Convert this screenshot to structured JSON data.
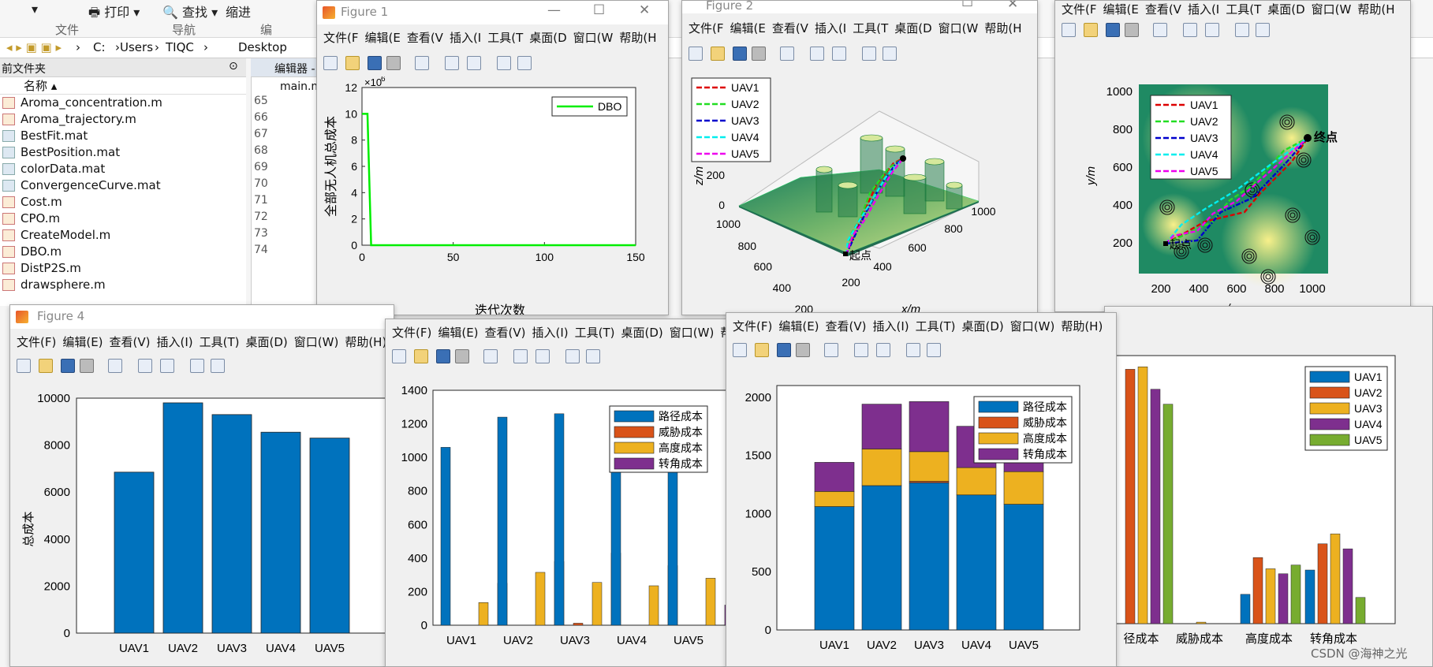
{
  "ribbon": {
    "print_label": "打印",
    "find_label": "查找",
    "indent_label": "缩进",
    "group_file": "文件",
    "group_nav": "导航",
    "group_edit": "编"
  },
  "address": {
    "parts": [
      "C:",
      "Users",
      "TIQC",
      "Desktop"
    ],
    "seps": [
      "›",
      "›",
      "›",
      "›"
    ]
  },
  "folder_panel": {
    "title": "前文件夹",
    "col_name": "名称 ▴",
    "files": [
      "Aroma_concentration.m",
      "Aroma_trajectory.m",
      "BestFit.mat",
      "BestPosition.mat",
      "colorData.mat",
      "ConvergenceCurve.mat",
      "Cost.m",
      "CPO.m",
      "CreateModel.m",
      "DBO.m",
      "DistP2S.m",
      "drawsphere.m"
    ]
  },
  "editor": {
    "title": "编辑器 -",
    "tab": "main.m",
    "line_numbers": [
      "65",
      "66",
      "67",
      "68",
      "69",
      "70",
      "71",
      "72",
      "73",
      "74"
    ]
  },
  "menus": {
    "full": [
      "文件(F)",
      "编辑(E)",
      "查看(V)",
      "插入(I)",
      "工具(T)",
      "桌面(D)",
      "窗口(W)",
      "帮助(H)"
    ],
    "fig1": [
      "文件(F",
      "编辑(E",
      "查看(V",
      "插入(I",
      "工具(T",
      "桌面(D",
      "窗口(W",
      "帮助(H"
    ],
    "fig2": [
      "文件(F",
      "编辑(E",
      "查看(V",
      "插入(I",
      "工具(T",
      "桌面(D",
      "窗口(W",
      "帮助(H"
    ],
    "fig3": [
      "文件(F",
      "编辑(E",
      "查看(V",
      "插入(I",
      "工具(T",
      "桌面(D",
      "窗口(W",
      "帮助(H"
    ],
    "fig_bar": [
      "文件(F)",
      "编辑(E)",
      "查看(V)",
      "插入(I)",
      "工具(T)",
      "桌面(D)",
      "窗口(W)",
      "帮助("
    ]
  },
  "windows": {
    "fig1": {
      "title": "Figure 1",
      "min": "—",
      "max": "☐",
      "close": "✕"
    },
    "fig2": {
      "title": "Figure 2",
      "max": "☐",
      "close": "✕"
    },
    "fig4": {
      "title": "Figure 4"
    }
  },
  "colors": {
    "blue": "#0072BD",
    "orange": "#D95319",
    "yellow": "#EDB120",
    "purple": "#7E2F8E",
    "green": "#77AC30",
    "dbo": "#00EE00"
  },
  "chart_data": [
    {
      "type": "line",
      "id": "convergence",
      "series": [
        {
          "name": "DBO",
          "x": [
            0,
            3,
            5,
            150
          ],
          "y": [
            10000000,
            10000000,
            0,
            0
          ]
        }
      ],
      "xlabel": "迭代次数",
      "ylabel": "全部无人机总成本",
      "xlim": [
        0,
        150
      ],
      "ylim": [
        0,
        12
      ],
      "exponent": "×10",
      "exponent_power": "6",
      "xticks": [
        "0",
        "50",
        "100",
        "150"
      ],
      "yticks": [
        "0",
        "2",
        "4",
        "6",
        "8",
        "10",
        "12"
      ]
    },
    {
      "type": "line",
      "id": "path3d",
      "series": [
        {
          "name": "UAV1"
        },
        {
          "name": "UAV2"
        },
        {
          "name": "UAV3"
        },
        {
          "name": "UAV4"
        },
        {
          "name": "UAV5"
        }
      ],
      "xlabel": "x/m",
      "zlabel": "z/m",
      "start_label": "起点",
      "xticks": [
        "200",
        "400",
        "600",
        "800",
        "1000"
      ],
      "yticks": [
        "200",
        "400",
        "600",
        "800",
        "1000"
      ],
      "zticks": [
        "0",
        "200"
      ]
    },
    {
      "type": "line",
      "id": "path2d",
      "series": [
        {
          "name": "UAV1"
        },
        {
          "name": "UAV2"
        },
        {
          "name": "UAV3"
        },
        {
          "name": "UAV4"
        },
        {
          "name": "UAV5"
        }
      ],
      "xlabel": "x/m",
      "ylabel": "y/m",
      "start_label": "起点",
      "end_label": "终点",
      "xticks": [
        "200",
        "400",
        "600",
        "800",
        "1000"
      ],
      "yticks": [
        "200",
        "400",
        "600",
        "800",
        "1000"
      ]
    },
    {
      "type": "bar",
      "id": "total_cost",
      "categories": [
        "UAV1",
        "UAV2",
        "UAV3",
        "UAV4",
        "UAV5"
      ],
      "values": [
        6850,
        9800,
        9300,
        8550,
        8300
      ],
      "ylabel": "总成本",
      "ylim": [
        0,
        10000
      ],
      "yticks": [
        "0",
        "2000",
        "4000",
        "6000",
        "8000",
        "10000"
      ]
    },
    {
      "type": "bar",
      "id": "cost_grouped",
      "categories": [
        "UAV1",
        "UAV2",
        "UAV3",
        "UAV4",
        "UAV5"
      ],
      "series": [
        {
          "name": "路径成本",
          "values": [
            1060,
            1240,
            1260,
            1160,
            1080
          ]
        },
        {
          "name": "威胁成本",
          "values": [
            0,
            0,
            12,
            0,
            0
          ]
        },
        {
          "name": "高度成本",
          "values": [
            135,
            315,
            255,
            235,
            280
          ]
        },
        {
          "name": "转角成本",
          "values": [
            250,
            380,
            430,
            355,
            120
          ]
        }
      ],
      "ylim": [
        0,
        1400
      ],
      "yticks": [
        "0",
        "200",
        "400",
        "600",
        "800",
        "1000",
        "1200",
        "1400"
      ]
    },
    {
      "type": "bar",
      "id": "cost_stacked",
      "categories": [
        "UAV1",
        "UAV2",
        "UAV3",
        "UAV4",
        "UAV5"
      ],
      "series": [
        {
          "name": "路径成本",
          "values": [
            1060,
            1240,
            1265,
            1160,
            1080
          ]
        },
        {
          "name": "威胁成本",
          "values": [
            0,
            0,
            12,
            0,
            0
          ]
        },
        {
          "name": "高度成本",
          "values": [
            130,
            315,
            255,
            235,
            280
          ]
        },
        {
          "name": "转角成本",
          "values": [
            250,
            385,
            430,
            355,
            125
          ]
        }
      ],
      "ylim": [
        0,
        2100
      ],
      "yticks": [
        "0",
        "500",
        "1000",
        "1500",
        "2000"
      ]
    },
    {
      "type": "bar",
      "id": "cost_by_type",
      "categories": [
        "径成本",
        "威胁成本",
        "高度成本",
        "转角成本"
      ],
      "series": [
        {
          "name": "UAV1",
          "values": [
            0,
            0,
            235,
            430
          ]
        },
        {
          "name": "UAV2",
          "values": [
            2040,
            0,
            530,
            640
          ]
        },
        {
          "name": "UAV3",
          "values": [
            2060,
            12,
            440,
            720
          ]
        },
        {
          "name": "UAV4",
          "values": [
            1880,
            0,
            400,
            600
          ]
        },
        {
          "name": "UAV5",
          "values": [
            1760,
            0,
            470,
            210
          ]
        }
      ]
    }
  ],
  "watermark": "CSDN @海神之光"
}
